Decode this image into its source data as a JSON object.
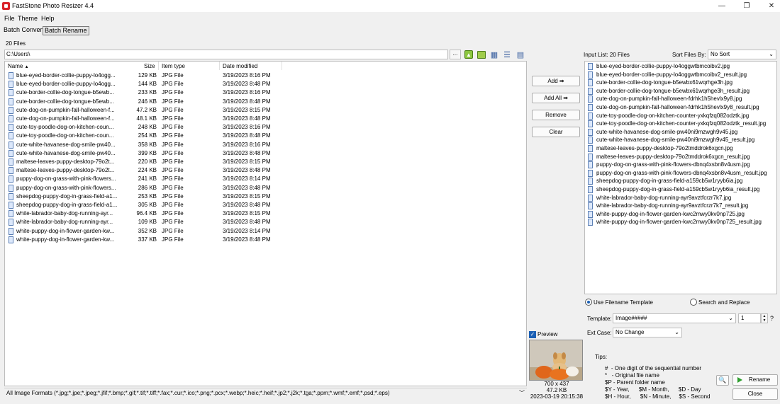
{
  "window": {
    "title": "FastStone Photo Resizer 4.4",
    "minimize": "—",
    "maximize": "❐",
    "close": "✕"
  },
  "menu": [
    "File",
    "Theme",
    "Help"
  ],
  "modes": {
    "batch_convert": "Batch Convert",
    "batch_rename": "Batch Rename"
  },
  "files_count": "20 Files",
  "path": {
    "value": "C:\\Users\\",
    "browse": "..."
  },
  "file_list": {
    "headers": {
      "name": "Name",
      "size": "Size",
      "type": "Item type",
      "date": "Date modified"
    },
    "rows": [
      {
        "name": "blue-eyed-border-collie-puppy-lo4ogg...",
        "size": "129 KB",
        "type": "JPG File",
        "date": "3/19/2023 8:16 PM"
      },
      {
        "name": "blue-eyed-border-collie-puppy-lo4ogg...",
        "size": "144 KB",
        "type": "JPG File",
        "date": "3/19/2023 8:48 PM"
      },
      {
        "name": "cute-border-collie-dog-tongue-b5ewb...",
        "size": "233 KB",
        "type": "JPG File",
        "date": "3/19/2023 8:16 PM"
      },
      {
        "name": "cute-border-collie-dog-tongue-b5ewb...",
        "size": "246 KB",
        "type": "JPG File",
        "date": "3/19/2023 8:48 PM"
      },
      {
        "name": "cute-dog-on-pumpkin-fall-halloween-f...",
        "size": "47.2 KB",
        "type": "JPG File",
        "date": "3/19/2023 8:15 PM"
      },
      {
        "name": "cute-dog-on-pumpkin-fall-halloween-f...",
        "size": "48.1 KB",
        "type": "JPG File",
        "date": "3/19/2023 8:48 PM"
      },
      {
        "name": "cute-toy-poodle-dog-on-kitchen-coun...",
        "size": "248 KB",
        "type": "JPG File",
        "date": "3/19/2023 8:16 PM"
      },
      {
        "name": "cute-toy-poodle-dog-on-kitchen-coun...",
        "size": "254 KB",
        "type": "JPG File",
        "date": "3/19/2023 8:48 PM"
      },
      {
        "name": "cute-white-havanese-dog-smile-pw40...",
        "size": "358 KB",
        "type": "JPG File",
        "date": "3/19/2023 8:16 PM"
      },
      {
        "name": "cute-white-havanese-dog-smile-pw40...",
        "size": "399 KB",
        "type": "JPG File",
        "date": "3/19/2023 8:48 PM"
      },
      {
        "name": "maltese-leaves-puppy-desktop-79o2t...",
        "size": "220 KB",
        "type": "JPG File",
        "date": "3/19/2023 8:15 PM"
      },
      {
        "name": "maltese-leaves-puppy-desktop-79o2t...",
        "size": "224 KB",
        "type": "JPG File",
        "date": "3/19/2023 8:48 PM"
      },
      {
        "name": "puppy-dog-on-grass-with-pink-flowers...",
        "size": "241 KB",
        "type": "JPG File",
        "date": "3/19/2023 8:14 PM"
      },
      {
        "name": "puppy-dog-on-grass-with-pink-flowers...",
        "size": "286 KB",
        "type": "JPG File",
        "date": "3/19/2023 8:48 PM"
      },
      {
        "name": "sheepdog-puppy-dog-in-grass-field-a1...",
        "size": "253 KB",
        "type": "JPG File",
        "date": "3/19/2023 8:15 PM"
      },
      {
        "name": "sheepdog-puppy-dog-in-grass-field-a1...",
        "size": "305 KB",
        "type": "JPG File",
        "date": "3/19/2023 8:48 PM"
      },
      {
        "name": "white-labrador-baby-dog-running-ayr...",
        "size": "96.4 KB",
        "type": "JPG File",
        "date": "3/19/2023 8:15 PM"
      },
      {
        "name": "white-labrador-baby-dog-running-ayr...",
        "size": "109 KB",
        "type": "JPG File",
        "date": "3/19/2023 8:48 PM"
      },
      {
        "name": "white-puppy-dog-in-flower-garden-kw...",
        "size": "352 KB",
        "type": "JPG File",
        "date": "3/19/2023 8:14 PM"
      },
      {
        "name": "white-puppy-dog-in-flower-garden-kw...",
        "size": "337 KB",
        "type": "JPG File",
        "date": "3/19/2023 8:48 PM"
      }
    ]
  },
  "filter": {
    "value": "All Image Formats (*.jpg;*.jpe;*.jpeg;*.jfif;*.bmp;*.gif;*.tif;*.tiff;*.fax;*.cur;*.ico;*.png;*.pcx;*.webp;*.heic;*.heif;*.jp2;*.j2k;*.tga;*.ppm;*.wmf;*.emf;*.psd;*.eps)"
  },
  "buttons": {
    "add": "Add ➡",
    "add_all": "Add All ➡",
    "remove": "Remove",
    "clear": "Clear",
    "rename": "Rename",
    "close": "Close"
  },
  "preview": {
    "label": "Preview",
    "checked": true,
    "dimensions": "700 x 437",
    "size": "47.2 KB",
    "timestamp": "2023-03-19 20:15:38"
  },
  "input_list": {
    "label": "Input List:  20 Files",
    "sort_label": "Sort Files By:",
    "sort_value": "No Sort",
    "items": [
      "blue-eyed-border-collie-puppy-lo4oggwtbmcoibv2.jpg",
      "blue-eyed-border-collie-puppy-lo4oggwtbmcoibv2_result.jpg",
      "cute-border-collie-dog-tongue-b5ewbx61wqrhge3h.jpg",
      "cute-border-collie-dog-tongue-b5ewbx61wqrhge3h_result.jpg",
      "cute-dog-on-pumpkin-fall-halloween-fdrhk1h5hevlx9y8.jpg",
      "cute-dog-on-pumpkin-fall-halloween-fdrhk1h5hevlx9y8_result.jpg",
      "cute-toy-poodle-dog-on-kitchen-counter-yxkqfzq082odztk.jpg",
      "cute-toy-poodle-dog-on-kitchen-counter-yxkqfzq082odztk_result.jpg",
      "cute-white-havanese-dog-smile-pw40ni9mzwgh9v45.jpg",
      "cute-white-havanese-dog-smile-pw40ni9mzwgh9v45_result.jpg",
      "maltese-leaves-puppy-desktop-79o2tmddrok6xgcn.jpg",
      "maltese-leaves-puppy-desktop-79o2tmddrok6xgcn_result.jpg",
      "puppy-dog-on-grass-with-pink-flowers-dbnq4xsbn8v4usm.jpg",
      "puppy-dog-on-grass-with-pink-flowers-dbnq4xsbn8v4usm_result.jpg",
      "sheepdog-puppy-dog-in-grass-field-a159cb5w1ryyb6ia.jpg",
      "sheepdog-puppy-dog-in-grass-field-a159cb5w1ryyb6ia_result.jpg",
      "white-labrador-baby-dog-running-ayr9avztfcrzr7k7.jpg",
      "white-labrador-baby-dog-running-ayr9avztfcrzr7k7_result.jpg",
      "white-puppy-dog-in-flower-garden-kwc2mwy0kv0np725.jpg",
      "white-puppy-dog-in-flower-garden-kwc2mwy0kv0np725_result.jpg"
    ]
  },
  "rename_mode": {
    "template_option": "Use Filename Template",
    "replace_option": "Search and Replace",
    "selected": "template"
  },
  "template": {
    "label": "Template:",
    "value": "Image#####",
    "start": "1",
    "help": "?"
  },
  "ext_case": {
    "label": "Ext Case:",
    "value": "No Change"
  },
  "tips": {
    "title": "Tips:",
    "lines": [
      "#  - One digit of the sequential number",
      "*   - Original file name",
      "$P - Parent folder name",
      "$Y - Year,      $M - Month,      $D - Day",
      "$H - Hour,      $N - Minute,     $S - Second"
    ]
  },
  "colors": {
    "accent": "#1a5fb4",
    "go": "#2e9e2e",
    "app_icon": "#d9222a"
  }
}
